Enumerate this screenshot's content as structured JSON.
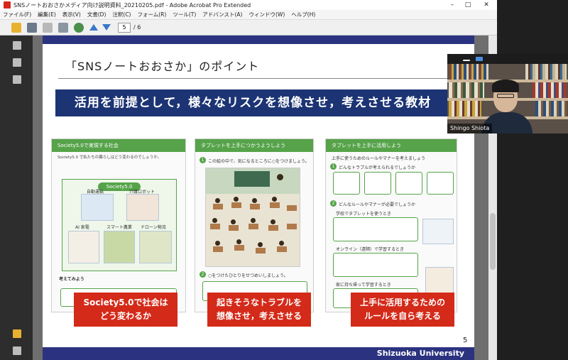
{
  "window": {
    "title": "SNSノートおおさかメディア向け説明資料_20210205.pdf - Adobe Acrobat Pro Extended",
    "controls": {
      "minimize": "–",
      "maximize": "□",
      "close": "✕"
    }
  },
  "menu": [
    "ファイル(F)",
    "編集(E)",
    "表示(V)",
    "文書(D)",
    "注釈(C)",
    "フォーム(R)",
    "ツール(T)",
    "アドバンスト(A)",
    "ウィンドウ(W)",
    "ヘルプ(H)"
  ],
  "toolbar": {
    "current_page": "5",
    "total_pages": "/ 6"
  },
  "slide": {
    "title": "「SNSノートおおさか」のポイント",
    "banner": "活用を前提として，様々なリスクを想像させ，考えさせる教材",
    "panels": [
      {
        "header": "Society5.0で実現する社会",
        "text": "Society5.0 で私たちの暮らしはどう変わるのでしょうか。",
        "inner_label": "Society5.0",
        "image_captions": [
          "自動運転",
          "介護ロボット",
          "AI 家電",
          "スマート農業",
          "ドローン物流"
        ],
        "question_label": "考えてみよう"
      },
      {
        "header": "タブレットを上手につかうようしよう",
        "q1": "この絵の中で、気になるところに○をつけましょう。",
        "q2": "○をつけたひとりをせつめいしましょう。"
      },
      {
        "header": "タブレットを上手に活用しよう",
        "text": "上手に使うためのルールやマナーを考えましょう",
        "q1": "どんなトラブルが考えられるでしょうか",
        "q2": "どんなルールやマナーが必要でしょうか",
        "sub_a": "学校でタブレットを使うとき",
        "sub_b": "オンライン（遠隔）で学習するとき",
        "sub_c": "家に持ち帰って学習するとき"
      }
    ],
    "labels": [
      {
        "line1": "Society5.0で社会は",
        "line2": "どう変わるか"
      },
      {
        "line1": "起きそうなトラブルを",
        "line2": "想像させ，考えさせる"
      },
      {
        "line1": "上手に活用するための",
        "line2": "ルールを自ら考える"
      }
    ],
    "page_number": "5",
    "footer": "Shizuoka University"
  },
  "video": {
    "participant": "Shingo Shiota"
  },
  "colors": {
    "navy": "#1c3474",
    "red": "#d42a19",
    "green": "#56a34a"
  }
}
